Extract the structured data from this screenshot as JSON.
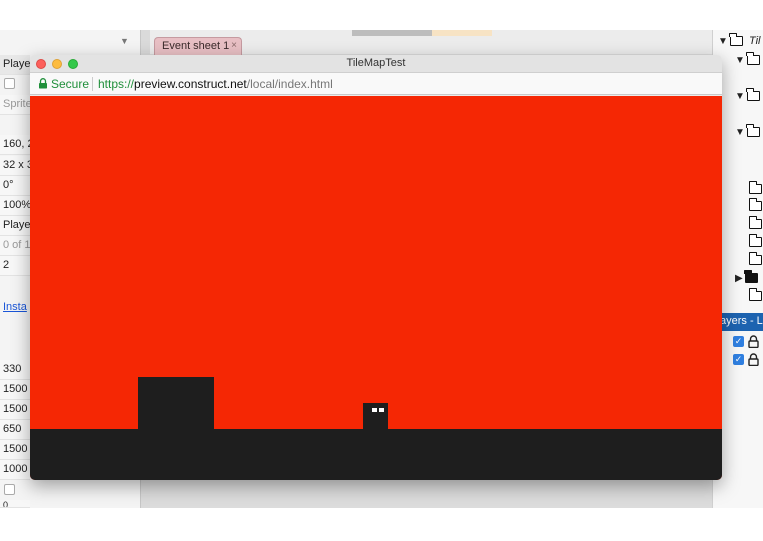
{
  "ide": {
    "left_panel": {
      "rows": [
        "Playe",
        "Sprite",
        "160, 2",
        "32 x 3",
        "0°",
        "100%",
        "Playe",
        "0 of 1",
        "2"
      ],
      "link": "Insta",
      "lower_values": [
        "330",
        "1500",
        "1500",
        "650",
        "1500",
        "1000",
        "0"
      ]
    },
    "event_tab": {
      "label": "Event sheet 1",
      "close": "×"
    },
    "right_panel": {
      "tree_label": "Til",
      "layers_header": "ayers - L"
    }
  },
  "preview_window": {
    "title": "TileMapTest",
    "address": {
      "secure_label": "Secure",
      "url_scheme": "https://",
      "url_host": "preview.construct.net",
      "url_path": "/local/index.html"
    },
    "game": {
      "background_color": "#f52704",
      "ground_color": "#1e1e1e"
    }
  }
}
